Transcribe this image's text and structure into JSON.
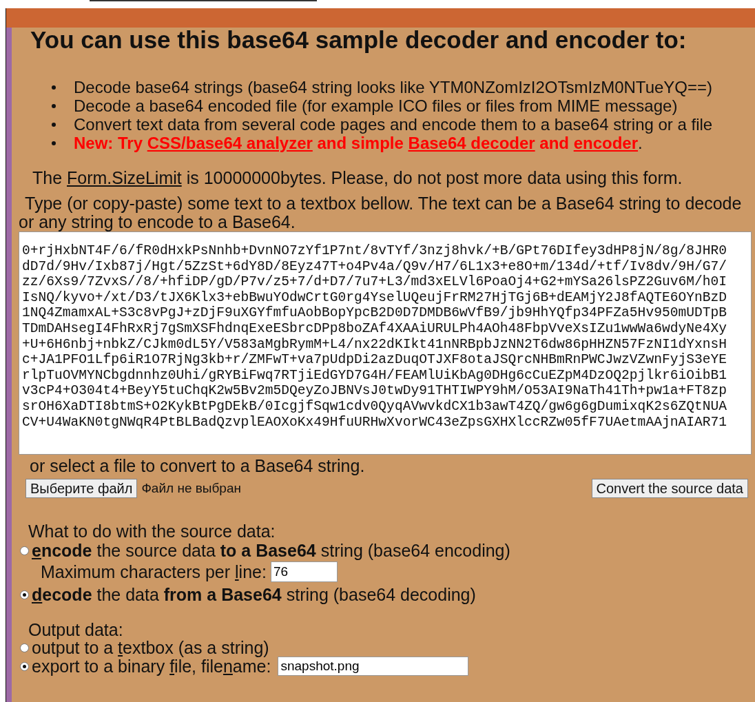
{
  "heading": "You can use this base64 sample decoder and encoder to:",
  "features": [
    {
      "kind": "plain",
      "segments": [
        {
          "text": "Decode base64 strings (base64 string looks like YTM0NZomIzI2OTsmIzM0NTueYQ==)",
          "kind": "text"
        }
      ]
    },
    {
      "kind": "plain",
      "segments": [
        {
          "text": "Decode a base64 encoded file (for example ICO files or files from MIME message)",
          "kind": "text"
        }
      ]
    },
    {
      "kind": "plain",
      "segments": [
        {
          "text": "Convert text data from several code pages and encode them to a base64 string or a file",
          "kind": "text"
        }
      ]
    },
    {
      "kind": "notice",
      "segments": [
        {
          "text": "New: Try ",
          "kind": "text"
        },
        {
          "text": "CSS/base64 analyzer",
          "kind": "link"
        },
        {
          "text": " and simple ",
          "kind": "text"
        },
        {
          "text": "Base64 decoder",
          "kind": "link"
        },
        {
          "text": " and ",
          "kind": "text"
        },
        {
          "text": "encoder",
          "kind": "link"
        },
        {
          "text": ".",
          "kind": "plain-text"
        }
      ]
    }
  ],
  "size_limit_note": [
    {
      "text": "The ",
      "kind": "text"
    },
    {
      "text": "Form.SizeLimit",
      "kind": "link"
    },
    {
      "text": " is 10000000bytes. Please, do not post more data using this form.",
      "kind": "text"
    }
  ],
  "instructions": "Type (or copy-paste) some text to a textbox bellow. The text can be a Base64 string to decode or any string to encode to a Base64.",
  "source_text": {
    "lines": [
      "0+rjHxbNT4F/6/fR0dHxkPsNnhb+DvnNO7zYf1P7nt/8vTYf/3nzj8hvk/+B/GPt76DIfey3dHP8jN/8g/8JHR0",
      "dD7d/9Hv/Ixb87j/Hgt/5ZzSt+6dY8D/8Eyz47T+o4Pv4a/Q9v/H7/6L1x3+e8O+m/134d/+tf/Iv8dv/9H/G7/",
      "zz/6Xs9/7ZvxS//8/+hfiDP/gD/P7v/z5+7/d+D7/7u7+L3/md3xELVl6PoaOj4+G2+mYSa26lsPZ2Guv6M/h0I",
      "IsNQ/kyvo+/xt/D3/tJX6Klx3+ebBwuYOdwCrtG0rg4YselUQeujFrRM27HjTGj6B+dEAMjY2J8fAQTE6OYnBzD",
      "1NQ4ZmamxAL+S3c8vPgJ+zDjF9uXGYfmfuAobBopYpcB2D0D7DMDB6wVfB9/jb9HhYQfp34PFZa5Hv950mUDTpB",
      "TDmDAHsegI4FhRxRj7gSmXSFhdnqExeESbrcDPp8boZAf4XAAiURULPh4AOh48FbpVveXsIZu1wwWa6wdyNe4Xy",
      "+U+6H6nbj+nbkZ/CJkm0dL5Y/V583aMgbRymM+L4/nx22dKIkt41nNRBpbJzNN2T6dw86pHHZN57FzNI1dYxnsH",
      "c+JA1PFO1Lfp6iR1O7RjNg3kb+r/ZMFwT+va7pUdpDi2azDuqOTJXF8otaJSQrcNHBmRnPWCJwzVZwnFyjS3eYE",
      "rlpTuOVMYNCbgdnnhz0Uhi/gRYBiFwq7RTjiEdGYD7G4H/FEAMlUiKbAg0DHg6cCuEZpM4DzOQ2pjlkr6iOibB1",
      "v3cP4+O304t4+BeyY5tuChqK2w5Bv2m5DQeyZoJBNVsJ0twDy91THTIWPY9hM/O53AI9NaTh41Th+pw1a+FT8zp",
      "srOH6XaDTI8btmS+O2KykBtPgDEkB/0IcgjfSqw1cdv0QyqAVwvkdCX1b3awT4ZQ/gw6g6gDumixqK2s6ZQtNUA",
      "CV+U4WaKN0tgNWqR4PtBLBadQzvplEAOXoKx49HfuURHwXvorWC43eZpsGXHXlccRZw05fF7UAetmAAjnAIAR71"
    ]
  },
  "file_note": "or select a file to convert to a Base64 string.",
  "file_picker": {
    "button": "Выберите файл",
    "status": "Файл не выбран"
  },
  "convert_button": "Convert the source data",
  "action": {
    "label": "What to do with the source data:",
    "options": [
      {
        "selected": false,
        "segments": [
          {
            "text": "e",
            "kind": "strong-key"
          },
          {
            "text": "ncode",
            "kind": "strong"
          },
          {
            "text": " the source data ",
            "kind": "text"
          },
          {
            "text": "to a Base64",
            "kind": "strong"
          },
          {
            "text": " string (base64 encoding)",
            "kind": "text"
          }
        ],
        "setting": {
          "segments": [
            {
              "text": "Maximum characters per ",
              "kind": "text"
            },
            {
              "text": "l",
              "kind": "key"
            },
            {
              "text": "ine:",
              "kind": "text"
            }
          ],
          "value": "76"
        }
      },
      {
        "selected": true,
        "segments": [
          {
            "text": "d",
            "kind": "strong-key"
          },
          {
            "text": "ecode",
            "kind": "strong"
          },
          {
            "text": " the data ",
            "kind": "text"
          },
          {
            "text": "from a Base64",
            "kind": "strong"
          },
          {
            "text": " string (base64 decoding)",
            "kind": "text"
          }
        ]
      }
    ]
  },
  "output": {
    "label": "Output data:",
    "options": [
      {
        "selected": false,
        "segments": [
          {
            "text": "output to a ",
            "kind": "text"
          },
          {
            "text": "t",
            "kind": "key"
          },
          {
            "text": "extbox (as a string)",
            "kind": "text"
          }
        ]
      },
      {
        "selected": true,
        "segments": [
          {
            "text": "export to a binary ",
            "kind": "text"
          },
          {
            "text": "f",
            "kind": "key"
          },
          {
            "text": "ile, file",
            "kind": "text"
          },
          {
            "text": "n",
            "kind": "key"
          },
          {
            "text": "ame:",
            "kind": "text"
          }
        ],
        "field": {
          "value": "snapshot.png"
        }
      }
    ]
  }
}
